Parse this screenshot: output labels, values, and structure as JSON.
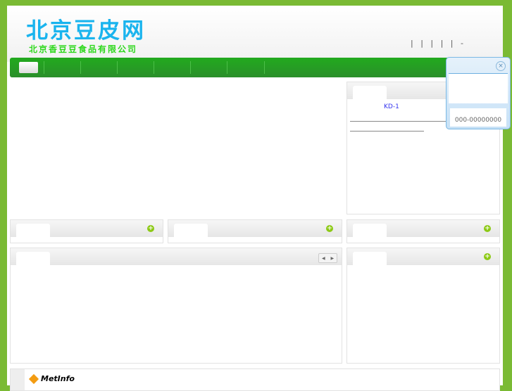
{
  "header": {
    "logo": "北京豆皮网",
    "subtitle": "北京香豆豆食品有限公司",
    "top_links": "| | | | | -"
  },
  "product": {
    "name": "KD-1"
  },
  "popup": {
    "phone": "000-00000000",
    "close": "×"
  },
  "icons": {
    "more": "+",
    "prev": "◀",
    "next": "▶"
  },
  "footer": {
    "brand": "MetInfo"
  }
}
